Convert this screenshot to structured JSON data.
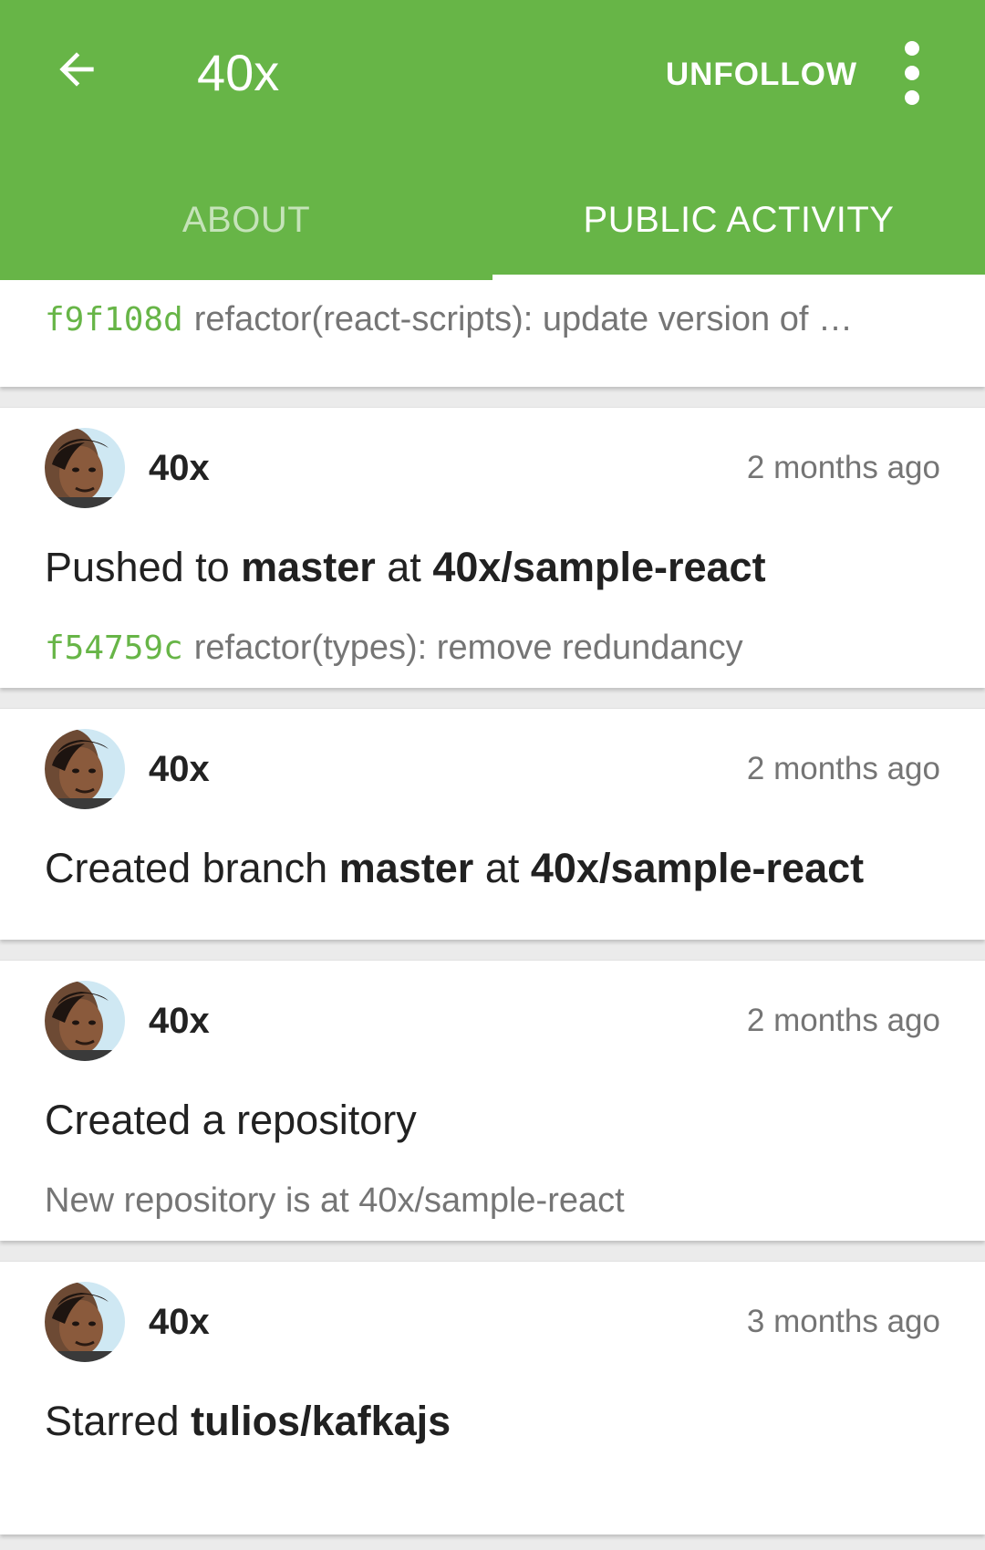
{
  "appbar": {
    "title": "40x",
    "unfollow_label": "UNFOLLOW",
    "color": "#67b547"
  },
  "tabs": [
    {
      "label": "ABOUT",
      "active": false
    },
    {
      "label": "PUBLIC ACTIVITY",
      "active": true
    }
  ],
  "feed": [
    {
      "type": "partial-commit",
      "sha": "f9f108d",
      "message": "refactor(react-scripts): update version of …"
    },
    {
      "type": "push",
      "user": "40x",
      "time": "2 months ago",
      "verb": "Pushed to",
      "ref": "master",
      "prep": "at",
      "repo": "40x/sample-react",
      "sha": "f54759c",
      "message": "refactor(types): remove redundancy"
    },
    {
      "type": "create-branch",
      "user": "40x",
      "time": "2 months ago",
      "verb": "Created branch",
      "ref": "master",
      "prep": "at",
      "repo": "40x/sample-react"
    },
    {
      "type": "create-repo",
      "user": "40x",
      "time": "2 months ago",
      "text": "Created a repository",
      "subtext": "New repository is at 40x/sample-react"
    },
    {
      "type": "star",
      "user": "40x",
      "time": "3 months ago",
      "verb": "Starred",
      "repo": "tulios/kafkajs"
    }
  ]
}
